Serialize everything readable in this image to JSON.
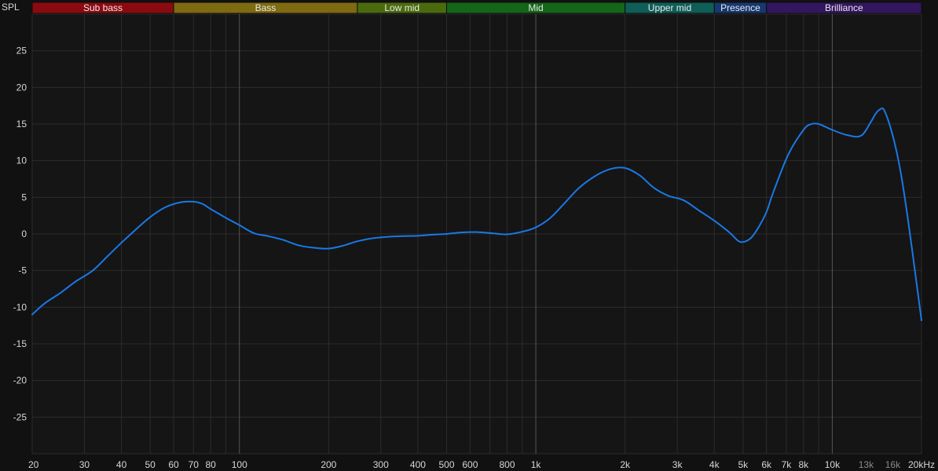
{
  "chart_data": {
    "type": "line",
    "ylabel": "SPL",
    "ylim": [
      -30,
      30
    ],
    "xlim": [
      20,
      20000
    ],
    "x_scale": "log",
    "grid": true,
    "bands": [
      {
        "name": "Sub bass",
        "from": 20,
        "to": 60,
        "color": "#8b0a10"
      },
      {
        "name": "Bass",
        "from": 60,
        "to": 250,
        "color": "#7e6a10"
      },
      {
        "name": "Low mid",
        "from": 250,
        "to": 500,
        "color": "#4b6a0e"
      },
      {
        "name": "Mid",
        "from": 500,
        "to": 2000,
        "color": "#146618"
      },
      {
        "name": "Upper mid",
        "from": 2000,
        "to": 4000,
        "color": "#0f5e58"
      },
      {
        "name": "Presence",
        "from": 4000,
        "to": 6000,
        "color": "#173870"
      },
      {
        "name": "Brilliance",
        "from": 6000,
        "to": 20000,
        "color": "#331660"
      }
    ],
    "y_ticks": [
      {
        "value": 25,
        "label": "25"
      },
      {
        "value": 20,
        "label": "20"
      },
      {
        "value": 15,
        "label": "15"
      },
      {
        "value": 10,
        "label": "10"
      },
      {
        "value": 5,
        "label": "5"
      },
      {
        "value": 0,
        "label": "0"
      },
      {
        "value": -5,
        "label": "-5"
      },
      {
        "value": -10,
        "label": "-10"
      },
      {
        "value": -15,
        "label": "-15"
      },
      {
        "value": -20,
        "label": "-20"
      },
      {
        "value": -25,
        "label": "-25"
      }
    ],
    "x_ticks": [
      {
        "value": 20,
        "label": "20"
      },
      {
        "value": 30,
        "label": "30"
      },
      {
        "value": 40,
        "label": "40"
      },
      {
        "value": 50,
        "label": "50"
      },
      {
        "value": 60,
        "label": "60"
      },
      {
        "value": 70,
        "label": "70"
      },
      {
        "value": 80,
        "label": "80"
      },
      {
        "value": 100,
        "label": "100"
      },
      {
        "value": 200,
        "label": "200"
      },
      {
        "value": 300,
        "label": "300"
      },
      {
        "value": 400,
        "label": "400"
      },
      {
        "value": 500,
        "label": "500"
      },
      {
        "value": 600,
        "label": "600"
      },
      {
        "value": 800,
        "label": "800"
      },
      {
        "value": 1000,
        "label": "1k"
      },
      {
        "value": 2000,
        "label": "2k"
      },
      {
        "value": 3000,
        "label": "3k"
      },
      {
        "value": 4000,
        "label": "4k"
      },
      {
        "value": 5000,
        "label": "5k"
      },
      {
        "value": 6000,
        "label": "6k"
      },
      {
        "value": 7000,
        "label": "7k"
      },
      {
        "value": 8000,
        "label": "8k"
      },
      {
        "value": 10000,
        "label": "10k"
      },
      {
        "value": 13000,
        "label": "13k",
        "dim": true
      },
      {
        "value": 16000,
        "label": "16k",
        "dim": true
      },
      {
        "value": 20000,
        "label": "20kHz"
      }
    ],
    "series": [
      {
        "color": "#1a78e6",
        "x": [
          20,
          22,
          25,
          28,
          32,
          36,
          40,
          45,
          50,
          56,
          63,
          70,
          75,
          80,
          90,
          100,
          112,
          125,
          140,
          160,
          180,
          200,
          224,
          250,
          280,
          315,
          355,
          400,
          450,
          500,
          560,
          630,
          710,
          800,
          900,
          1000,
          1120,
          1250,
          1400,
          1600,
          1800,
          2000,
          2240,
          2500,
          2800,
          3150,
          3550,
          4000,
          4500,
          4800,
          5000,
          5300,
          5600,
          6000,
          6300,
          7100,
          8000,
          8500,
          9000,
          9500,
          10000,
          11200,
          12500,
          13500,
          14000,
          14500,
          15000,
          16000,
          17000,
          18000,
          19000,
          20000
        ],
        "y": [
          -11,
          -9.5,
          -8,
          -6.5,
          -5,
          -3,
          -1.2,
          0.7,
          2.3,
          3.6,
          4.3,
          4.4,
          4.1,
          3.4,
          2.2,
          1.2,
          0.1,
          -0.3,
          -0.8,
          -1.6,
          -1.9,
          -2.0,
          -1.6,
          -1.0,
          -0.6,
          -0.4,
          -0.3,
          -0.25,
          -0.1,
          0.0,
          0.2,
          0.25,
          0.1,
          -0.05,
          0.3,
          0.9,
          2.2,
          4.2,
          6.3,
          8.0,
          8.9,
          9.0,
          8.0,
          6.3,
          5.2,
          4.6,
          3.2,
          1.8,
          0.2,
          -0.9,
          -1.1,
          -0.6,
          0.7,
          3.0,
          5.5,
          10.8,
          14.2,
          15.0,
          15.0,
          14.6,
          14.2,
          13.5,
          13.4,
          15.3,
          16.4,
          17.0,
          16.8,
          13.4,
          8.5,
          2.0,
          -5.0,
          -11.8
        ]
      }
    ]
  }
}
